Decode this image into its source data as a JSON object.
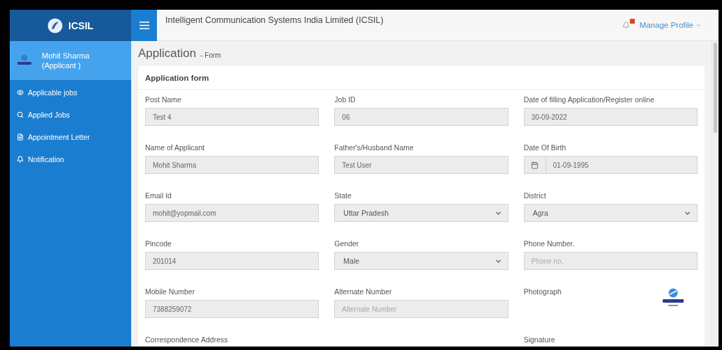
{
  "brand": {
    "name": "ICSIL"
  },
  "header": {
    "title": "Intelligent Communication Systems India Limited (ICSIL)",
    "profile_menu": "Manage Profile"
  },
  "user": {
    "name": "Mohit Sharma",
    "role": "(Applicant )"
  },
  "sidebar": {
    "items": [
      {
        "label": "Applicable jobs"
      },
      {
        "label": "Applied Jobs"
      },
      {
        "label": "Appointment Letter"
      },
      {
        "label": "Notification"
      }
    ]
  },
  "page": {
    "title": "Application",
    "subtitle": "- Form"
  },
  "form": {
    "title": "Application form",
    "rows": [
      [
        {
          "label": "Post Name",
          "kind": "text",
          "value": "Test 4"
        },
        {
          "label": "Job ID",
          "kind": "text",
          "value": "06"
        },
        {
          "label": "Date of filling Application/Register online",
          "kind": "text",
          "value": "30-09-2022"
        }
      ],
      [
        {
          "label": "Name of Applicant",
          "kind": "text",
          "value": "Mohit Sharma"
        },
        {
          "label": "Father's/Husband Name",
          "kind": "text",
          "value": "Test User"
        },
        {
          "label": "Date Of Birth",
          "kind": "date",
          "value": "01-09-1995"
        }
      ],
      [
        {
          "label": "Email Id",
          "kind": "text",
          "value": "mohit@yopmail.com"
        },
        {
          "label": "State",
          "kind": "select",
          "value": "Uttar Pradesh"
        },
        {
          "label": "District",
          "kind": "select",
          "value": "Agra"
        }
      ],
      [
        {
          "label": "Pincode",
          "kind": "text",
          "value": "201014"
        },
        {
          "label": "Gender",
          "kind": "select",
          "value": "Male"
        },
        {
          "label": "Phone Number.",
          "kind": "text",
          "placeholder": "Phone no."
        }
      ],
      [
        {
          "label": "Mobile Number",
          "kind": "text",
          "value": "7388259072"
        },
        {
          "label": "Alternate Number",
          "kind": "text",
          "placeholder": "Alternate Number"
        },
        {
          "label": "Photograph",
          "kind": "photo"
        }
      ],
      [
        {
          "label": "Correspondence Address",
          "kind": "label"
        },
        "",
        {
          "label": "Signature",
          "kind": "label"
        }
      ]
    ]
  }
}
